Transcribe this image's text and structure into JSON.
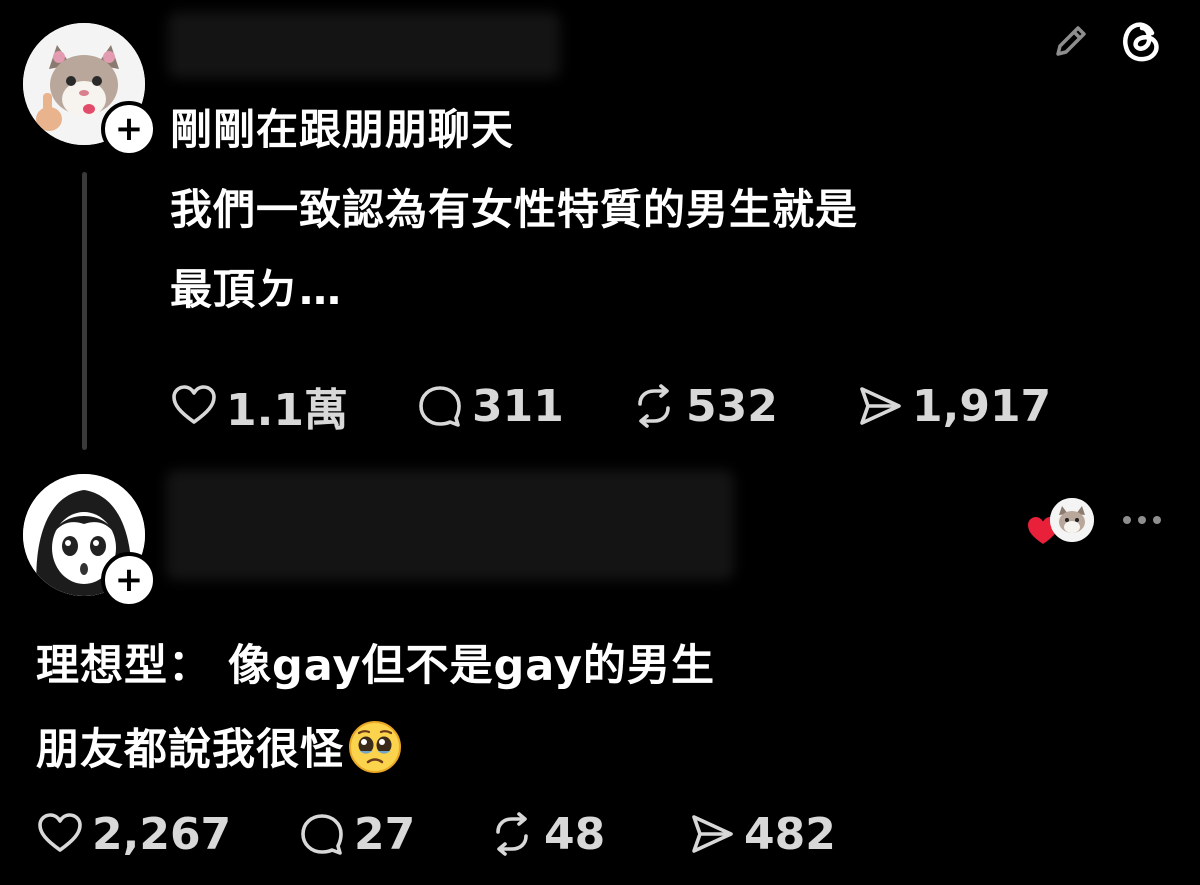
{
  "post1": {
    "text_lines": [
      "剛剛在跟朋朋聊天",
      "我們一致認為有女性特質的男生就是",
      "最頂ㄉ…"
    ],
    "stats": {
      "likes": "1.1萬",
      "replies": "311",
      "reposts": "532",
      "shares": "1,917"
    }
  },
  "post2": {
    "text_lines": [
      "理想型： 像gay但不是gay的男生",
      "朋友都說我很怪"
    ],
    "emoji": "pleading-face-emoji",
    "stats": {
      "likes": "2,267",
      "replies": "27",
      "reposts": "48",
      "shares": "482"
    }
  },
  "badges": {
    "follow_symbol": "+"
  },
  "icons": {
    "edit": "pencil-icon",
    "app": "threads-logo-icon",
    "like": "heart-icon",
    "reply": "comment-icon",
    "repost": "repost-icon",
    "share": "send-icon",
    "more": "more-dots-icon",
    "liked_by_author": "liked-heart-badge-icon"
  },
  "colors": {
    "background": "#000000",
    "text": "#ffffff",
    "stat_text": "#d8d8d8",
    "heart_red": "#e8203a",
    "thread_line": "#3a3a3a"
  }
}
